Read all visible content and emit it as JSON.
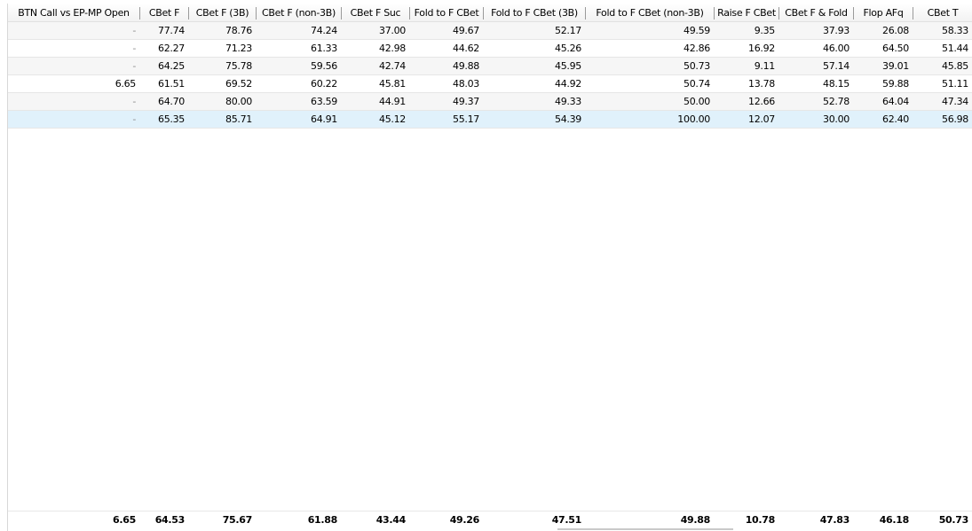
{
  "columns": [
    "BTN Call vs EP-MP Open",
    "CBet F",
    "CBet F (3B)",
    "CBet F (non-3B)",
    "CBet F Suc",
    "Fold to F CBet",
    "Fold to F CBet (3B)",
    "Fold to F CBet (non-3B)",
    "Raise F CBet",
    "CBet F & Fold",
    "Flop AFq",
    "CBet T"
  ],
  "rows": [
    [
      "-",
      "77.74",
      "78.76",
      "74.24",
      "37.00",
      "49.67",
      "52.17",
      "49.59",
      "9.35",
      "37.93",
      "26.08",
      "58.33"
    ],
    [
      "-",
      "62.27",
      "71.23",
      "61.33",
      "42.98",
      "44.62",
      "45.26",
      "42.86",
      "16.92",
      "46.00",
      "64.50",
      "51.44"
    ],
    [
      "-",
      "64.25",
      "75.78",
      "59.56",
      "42.74",
      "49.88",
      "45.95",
      "50.73",
      "9.11",
      "57.14",
      "39.01",
      "45.85"
    ],
    [
      "6.65",
      "61.51",
      "69.52",
      "60.22",
      "45.81",
      "48.03",
      "44.92",
      "50.74",
      "13.78",
      "48.15",
      "59.88",
      "51.11"
    ],
    [
      "-",
      "64.70",
      "80.00",
      "63.59",
      "44.91",
      "49.37",
      "49.33",
      "50.00",
      "12.66",
      "52.78",
      "64.04",
      "47.34"
    ],
    [
      "-",
      "65.35",
      "85.71",
      "64.91",
      "45.12",
      "55.17",
      "54.39",
      "100.00",
      "12.07",
      "30.00",
      "62.40",
      "56.98"
    ]
  ],
  "totals": [
    "6.65",
    "64.53",
    "75.67",
    "61.88",
    "43.44",
    "49.26",
    "47.51",
    "49.88",
    "10.78",
    "47.83",
    "46.18",
    "50.73"
  ],
  "selected_row_index": 5
}
